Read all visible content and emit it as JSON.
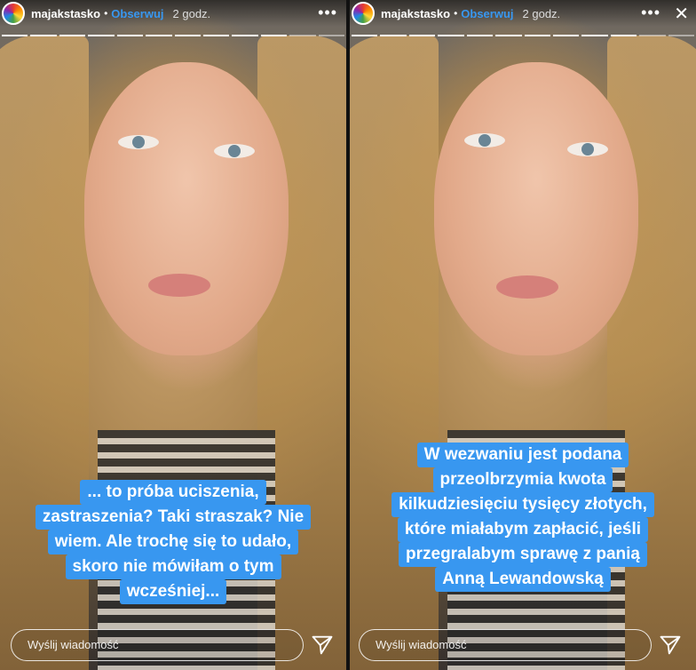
{
  "stories": [
    {
      "username": "majakstasko",
      "follow_label": "Obserwuj",
      "time": "2 godz.",
      "caption_lines": [
        "... to próba uciszenia,",
        "zastraszenia? Taki straszak? Nie",
        "wiem. Ale trochę się to udało,",
        "skoro nie mówiłam o tym",
        "wcześniej..."
      ],
      "reply_placeholder": "Wyślij wiadomość",
      "progress_segments": 12,
      "progress_done": 10
    },
    {
      "username": "majakstasko",
      "follow_label": "Obserwuj",
      "time": "2 godz.",
      "caption_lines": [
        "W wezwaniu jest podana",
        "przeolbrzymia kwota",
        "kilkudziesięciu tysięcy złotych,",
        "które miałabym zapłacić, jeśli",
        "przegralabym sprawę z panią",
        "Anną Lewandowską"
      ],
      "reply_placeholder": "Wyślij wiadomość",
      "progress_segments": 12,
      "progress_done": 10
    }
  ],
  "icons": {
    "more": "more-options-icon",
    "close": "close-icon",
    "send": "send-icon",
    "avatar": "profile-avatar"
  },
  "colors": {
    "accent": "#3897f0",
    "caption_bg": "#3897f0"
  }
}
